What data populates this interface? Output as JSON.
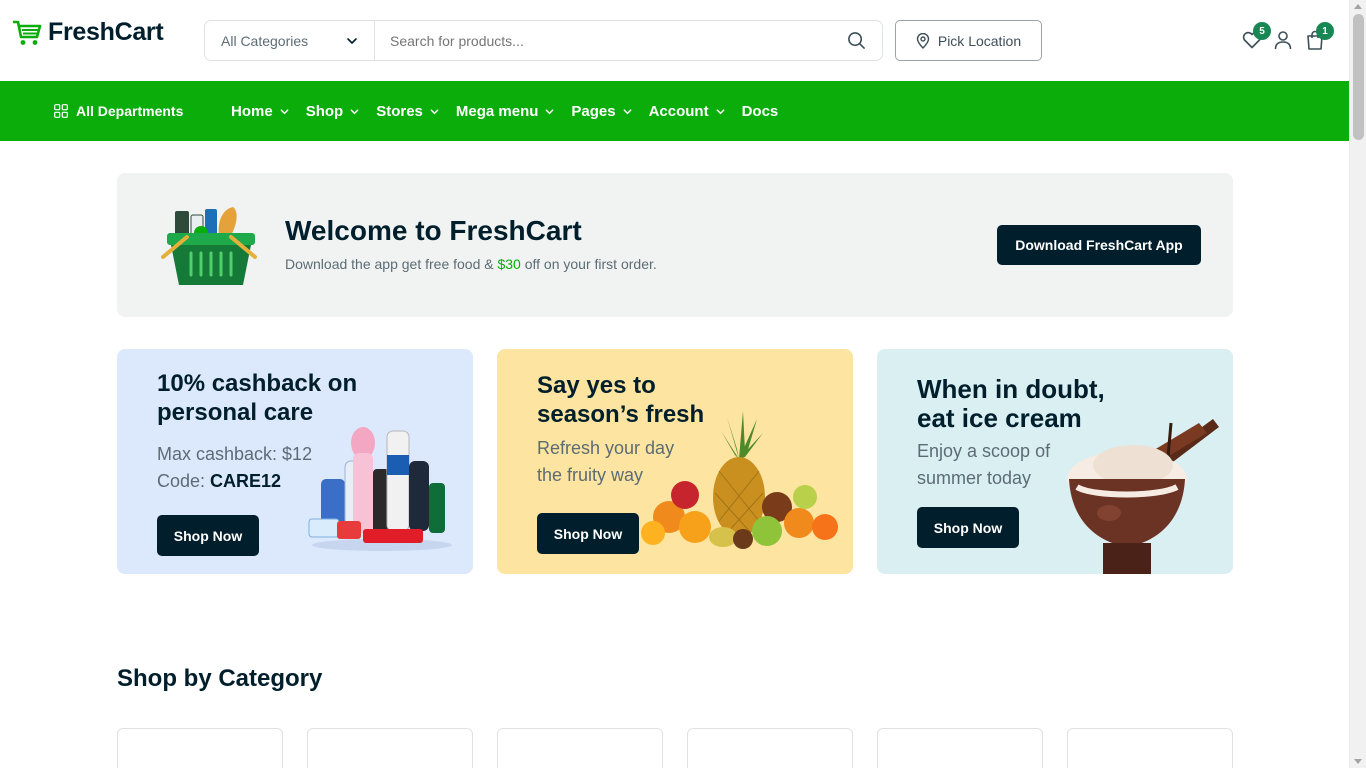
{
  "brand": {
    "name": "FreshCart",
    "accent": "#0aad0a",
    "dark": "#001e2b"
  },
  "search": {
    "category_label": "All Categories",
    "placeholder": "Search for products..."
  },
  "location_button": {
    "label": "Pick Location"
  },
  "header_icons": {
    "wishlist_count": "5",
    "cart_count": "1"
  },
  "nav": {
    "all_departments": "All Departments",
    "items": [
      {
        "label": "Home",
        "has_dropdown": true
      },
      {
        "label": "Shop",
        "has_dropdown": true
      },
      {
        "label": "Stores",
        "has_dropdown": true
      },
      {
        "label": "Mega menu",
        "has_dropdown": true
      },
      {
        "label": "Pages",
        "has_dropdown": true
      },
      {
        "label": "Account",
        "has_dropdown": true
      },
      {
        "label": "Docs",
        "has_dropdown": false
      }
    ]
  },
  "welcome": {
    "title": "Welcome to FreshCart",
    "sub_before": "Download the app get free food & ",
    "sub_amount": "$30",
    "sub_after": " off on your first order.",
    "button": "Download FreshCart App"
  },
  "promos": [
    {
      "title_line1": "10% cashback on",
      "title_line2": "personal care",
      "text_line1": "Max cashback: $12",
      "text_line2_label": "Code: ",
      "text_line2_code": "CARE12",
      "button": "Shop Now",
      "bg": "#dce9fd"
    },
    {
      "title_line1": "Say yes to",
      "title_line2": "season’s fresh",
      "text_line1": "Refresh your day",
      "text_line2": "the fruity way",
      "button": "Shop Now",
      "bg": "#fde4a0"
    },
    {
      "title_line1": "When in doubt,",
      "title_line2": "eat ice cream",
      "text_line1": "Enjoy a scoop of",
      "text_line2": "summer today",
      "button": "Shop Now",
      "bg": "#d9eff2"
    }
  ],
  "category": {
    "title": "Shop by Category",
    "cards": 6
  }
}
